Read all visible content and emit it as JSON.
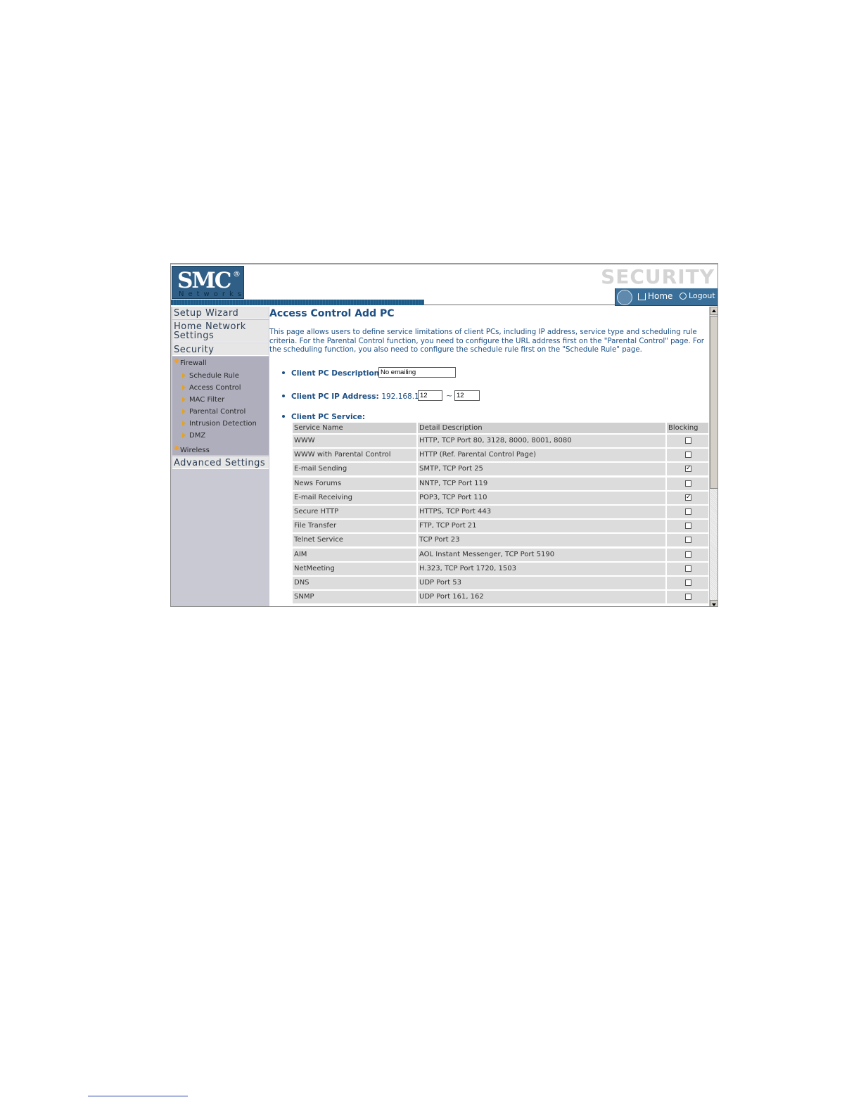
{
  "header": {
    "logo": "SMC",
    "logo_registered": "®",
    "logo_sub": "Networks",
    "section": "SECURITY",
    "home_label": "Home",
    "logout_label": "Logout",
    "voip_icon": "voip-globe-icon"
  },
  "sidebar": {
    "setup_wizard": "Setup Wizard",
    "home_network": "Home Network Settings",
    "security": "Security",
    "firewall": "Firewall",
    "firewall_items": [
      "Schedule Rule",
      "Access Control",
      "MAC Filter",
      "Parental Control",
      "Intrusion Detection",
      "DMZ"
    ],
    "wireless": "Wireless",
    "advanced": "Advanced Settings"
  },
  "main": {
    "title": "Access Control Add PC",
    "intro": "This page allows users to define service limitations of client PCs, including IP address, service type and scheduling rule criteria. For the Parental Control function, you need to configure the URL address first on the \"Parental Control\" page. For the scheduling function, you also need to configure the schedule rule first on the \"Schedule Rule\" page.",
    "description_label": "Client PC Description:",
    "description_value": "No emailing",
    "ip_label": "Client PC IP Address:",
    "ip_prefix": "192.168.1.",
    "ip_start": "12",
    "ip_sep": "~",
    "ip_end": "12",
    "service_label": "Client PC Service:",
    "table": {
      "headers": [
        "Service Name",
        "Detail Description",
        "Blocking"
      ],
      "rows": [
        {
          "name": "WWW",
          "detail": "HTTP, TCP Port 80, 3128, 8000, 8001, 8080",
          "blocked": false
        },
        {
          "name": "WWW with Parental Control",
          "detail": "HTTP (Ref. Parental Control Page)",
          "blocked": false
        },
        {
          "name": "E-mail Sending",
          "detail": "SMTP, TCP Port 25",
          "blocked": true
        },
        {
          "name": "News Forums",
          "detail": "NNTP, TCP Port 119",
          "blocked": false
        },
        {
          "name": "E-mail Receiving",
          "detail": "POP3, TCP Port 110",
          "blocked": true
        },
        {
          "name": "Secure HTTP",
          "detail": "HTTPS, TCP Port 443",
          "blocked": false
        },
        {
          "name": "File Transfer",
          "detail": "FTP, TCP Port 21",
          "blocked": false
        },
        {
          "name": "Telnet Service",
          "detail": "TCP Port 23",
          "blocked": false
        },
        {
          "name": "AIM",
          "detail": "AOL Instant Messenger, TCP Port 5190",
          "blocked": false
        },
        {
          "name": "NetMeeting",
          "detail": "H.323, TCP Port 1720, 1503",
          "blocked": false
        },
        {
          "name": "DNS",
          "detail": "UDP Port 53",
          "blocked": false
        },
        {
          "name": "SNMP",
          "detail": "UDP Port 161, 162",
          "blocked": false
        }
      ]
    }
  },
  "colors": {
    "title_blue": "#1c4f84",
    "logo_blue": "#2f5f86",
    "sidebar_bg": "#c9c9d3",
    "table_cell": "#dcdcdc"
  }
}
